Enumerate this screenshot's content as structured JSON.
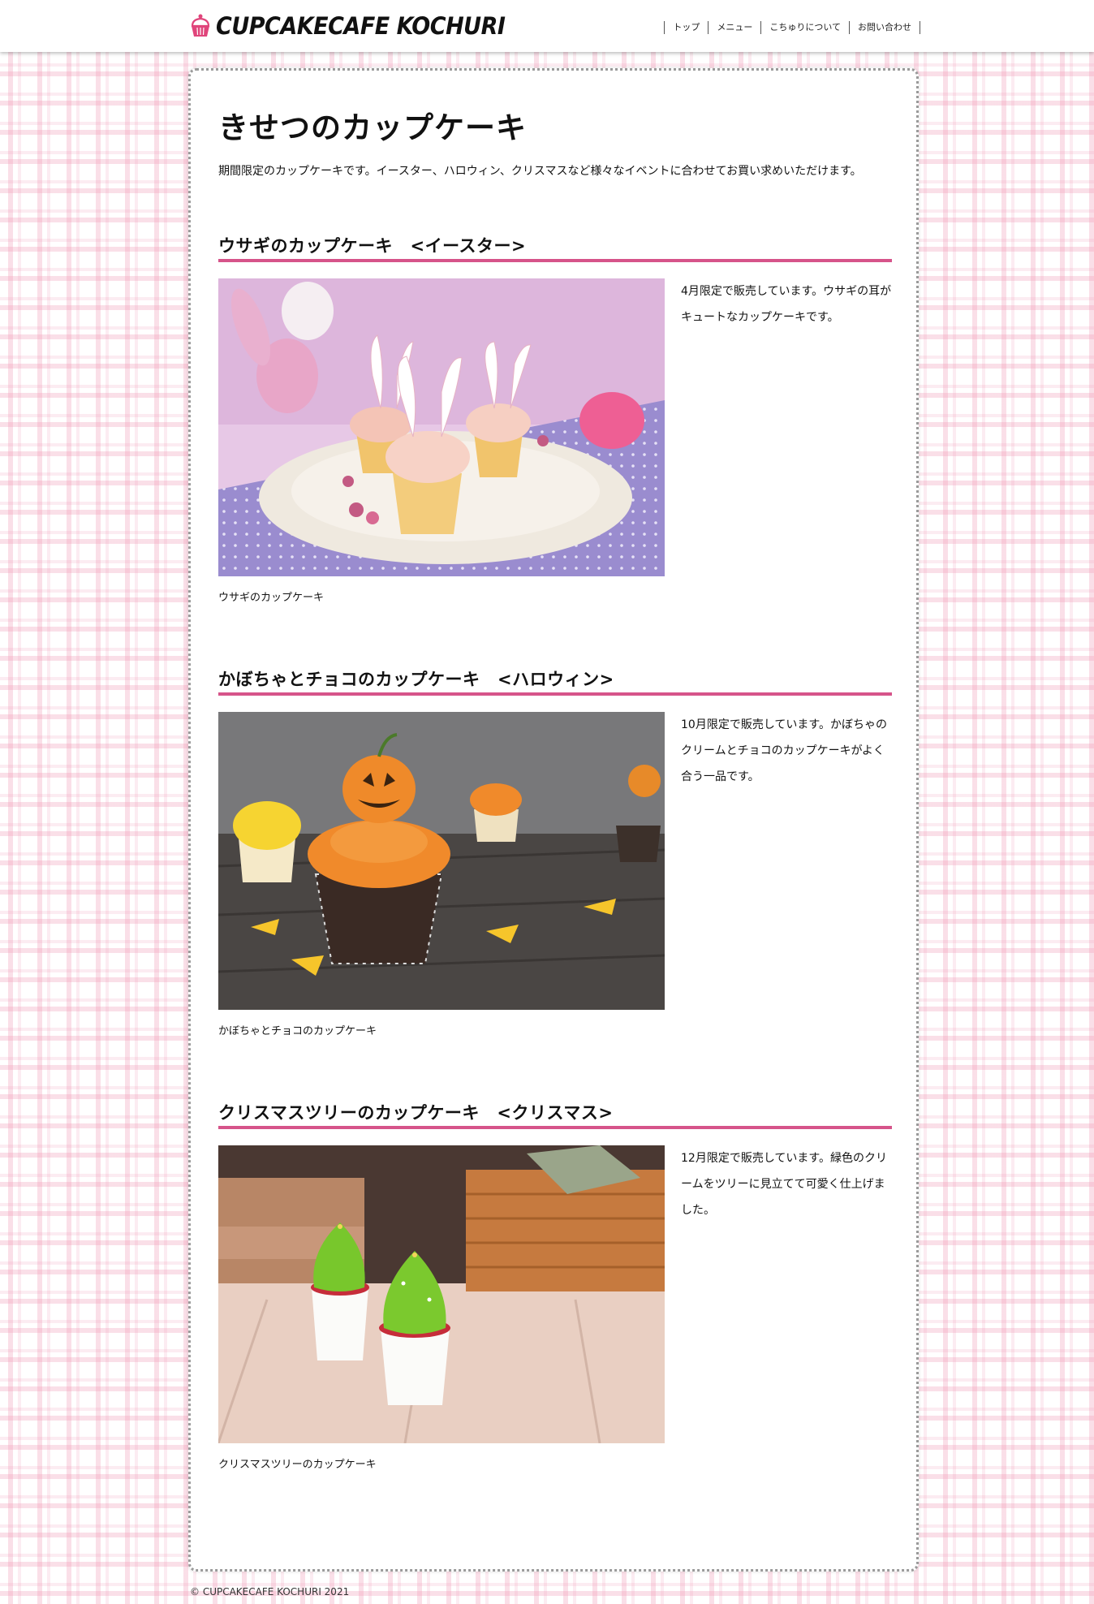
{
  "header": {
    "site_name": "CUPCAKECAFE KOCHURI",
    "nav": [
      "トップ",
      "メニュー",
      "こちゅりについて",
      "お問い合わせ"
    ]
  },
  "main": {
    "title": "きせつのカップケーキ",
    "intro": "期間限定のカップケーキです。イースター、ハロウィン、クリスマスなど様々なイベントに合わせてお買い求めいただけます。",
    "sections": [
      {
        "heading": "ウサギのカップケーキ　<イースター>",
        "description": "4月限定で販売しています。ウサギの耳がキュートなカップケーキです。",
        "caption": "ウサギのカップケーキ"
      },
      {
        "heading": "かぼちゃとチョコのカップケーキ　<ハロウィン>",
        "description": "10月限定で販売しています。かぼちゃのクリームとチョコのカップケーキがよく合う一品です。",
        "caption": "かぼちゃとチョコのカップケーキ"
      },
      {
        "heading": "クリスマスツリーのカップケーキ　<クリスマス>",
        "description": "12月限定で販売しています。緑色のクリームをツリーに見立てて可愛く仕上げました。",
        "caption": "クリスマスツリーのカップケーキ"
      }
    ]
  },
  "footer": {
    "copyright": "© CUPCAKECAFE KOCHURI 2021"
  },
  "colors": {
    "accent": "#d6548a",
    "logo_icon": "#e0457b"
  },
  "icons": {
    "logo": "cupcake-icon"
  }
}
